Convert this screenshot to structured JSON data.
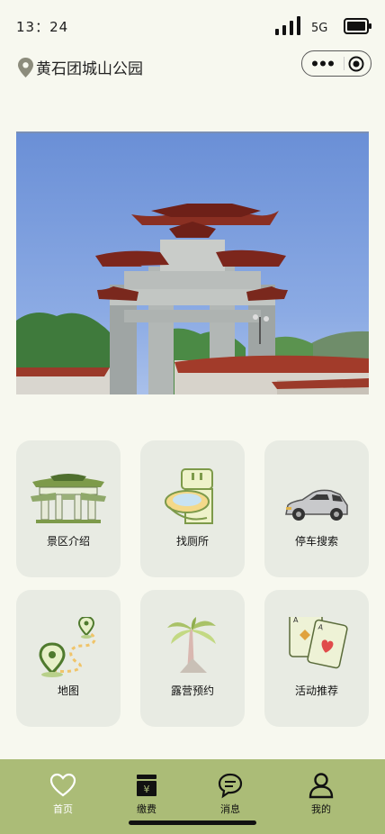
{
  "status": {
    "time": "13：24",
    "network": "5G"
  },
  "header": {
    "location_name": "黄石团城山公园"
  },
  "features": [
    {
      "label": "景区介绍",
      "icon": "archway-icon"
    },
    {
      "label": "找厕所",
      "icon": "toilet-icon"
    },
    {
      "label": "停车搜索",
      "icon": "car-icon"
    },
    {
      "label": "地图",
      "icon": "map-route-icon"
    },
    {
      "label": "露营预约",
      "icon": "palm-tree-icon"
    },
    {
      "label": "活动推荐",
      "icon": "playing-cards-icon"
    }
  ],
  "tabbar": {
    "items": [
      {
        "label": "首页",
        "icon": "heart-icon",
        "active": true
      },
      {
        "label": "缴费",
        "icon": "payment-box-icon",
        "active": false
      },
      {
        "label": "消息",
        "icon": "chat-bubble-icon",
        "active": false
      },
      {
        "label": "我的",
        "icon": "person-icon",
        "active": false
      }
    ]
  },
  "colors": {
    "background": "#f7f8ef",
    "tabbar": "#abbc77",
    "tile": "#e8ebe3",
    "accent_green": "#7d9a4a"
  }
}
